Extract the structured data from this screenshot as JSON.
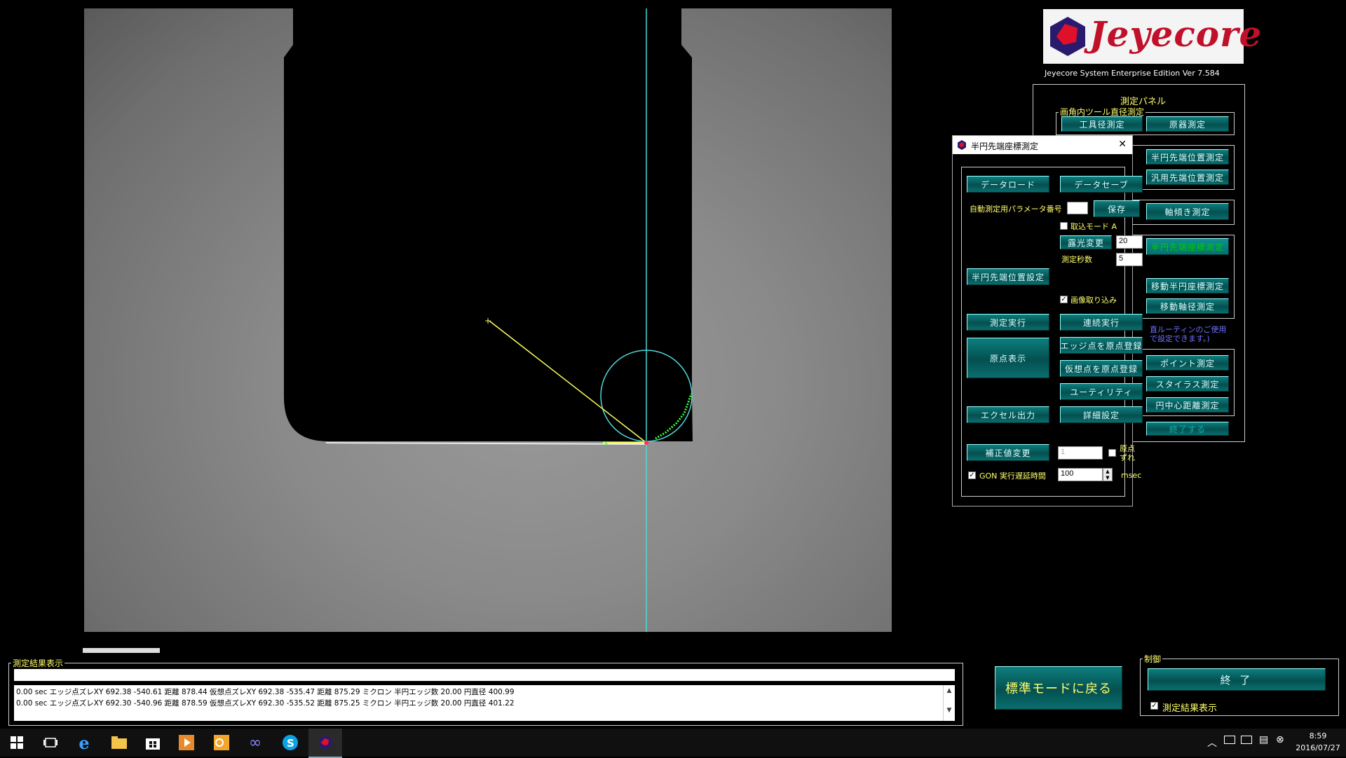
{
  "logo": {
    "text": "Jeyecore",
    "edition": "Jeyecore System Enterprise Edition Ver 7.584"
  },
  "right_panel": {
    "title": "測定パネル",
    "group_title": "画角内ツール直径測定",
    "buttons": {
      "tool_diameter": "工具径測定",
      "origin": "原器測定",
      "semicircle_tip": "半円先端位置測定",
      "general_tip": "汎用先端位置測定",
      "axis_tilt": "軸傾き測定",
      "hidden_green": "半円先端座標測定",
      "move_semicircle": "移動半円座標測定",
      "move_axis": "移動軸径測定",
      "point": "ポイント測定",
      "stylus": "スタイラス測定",
      "circle_center": "円中心距離測定",
      "bottom_partial": "終了する"
    },
    "note_line1": "直ルーティンのご使用",
    "note_line2": "で設定できます。)"
  },
  "dialog": {
    "title": "半円先端座標測定",
    "close": "✕",
    "data_load": "データロード",
    "data_save": "データセーブ",
    "param_label": "自動測定用パラメータ番号",
    "param_value": "",
    "save": "保存",
    "capture_mode": "取込モード A",
    "exposure_change": "露光変更",
    "exposure_value": "20",
    "measure_sec_label": "測定秒数",
    "measure_sec_value": "5",
    "semicircle_setting": "半円先端位置設定",
    "image_capture": "画像取り込み",
    "measure_exec": "測定実行",
    "continuous_exec": "連続実行",
    "origin_display": "原点表示",
    "edge_origin": "エッジ点を原点登録",
    "virtual_origin": "仮想点を原点登録",
    "utility": "ユーティリティ",
    "detail_setting": "詳細設定",
    "excel_output": "エクセル出力",
    "correction_change": "補正値変更",
    "correction_value": "1",
    "origin_shift_1": "原点",
    "origin_shift_2": "ずれ",
    "gon_label": "GON 実行遅延時間",
    "delay_value": "100",
    "msec": "msec"
  },
  "results": {
    "title": "測定結果表示",
    "lines": [
      "0.00 sec エッジ点ズレXY 692.38 -540.61 距離 878.44 仮想点ズレXY 692.38 -535.47 距離 875.29 ミクロン 半円エッジ数 20.00 円直径 400.99",
      "0.00 sec エッジ点ズレXY 692.30 -540.96 距離 878.59 仮想点ズレXY 692.30 -535.52 距離 875.25 ミクロン 半円エッジ数 20.00 円直径 401.22"
    ]
  },
  "return_button": "標準モードに戻る",
  "control": {
    "title": "制御",
    "exit": "終 了",
    "show_results": "測定結果表示"
  },
  "taskbar": {
    "time": "8:59",
    "date": "2016/07/27",
    "icons": [
      "windows-start",
      "task-view",
      "internet-explorer",
      "file-explorer",
      "store",
      "media-player",
      "outlook",
      "app-infinity",
      "skype",
      "jeyecore-app"
    ]
  },
  "colors": {
    "accent": "#0a6e6e",
    "label": "#ffff6e",
    "overlay_cyan": "#4fd8d8",
    "overlay_yellow": "#ffff60",
    "edge_green": "#40ff40"
  }
}
